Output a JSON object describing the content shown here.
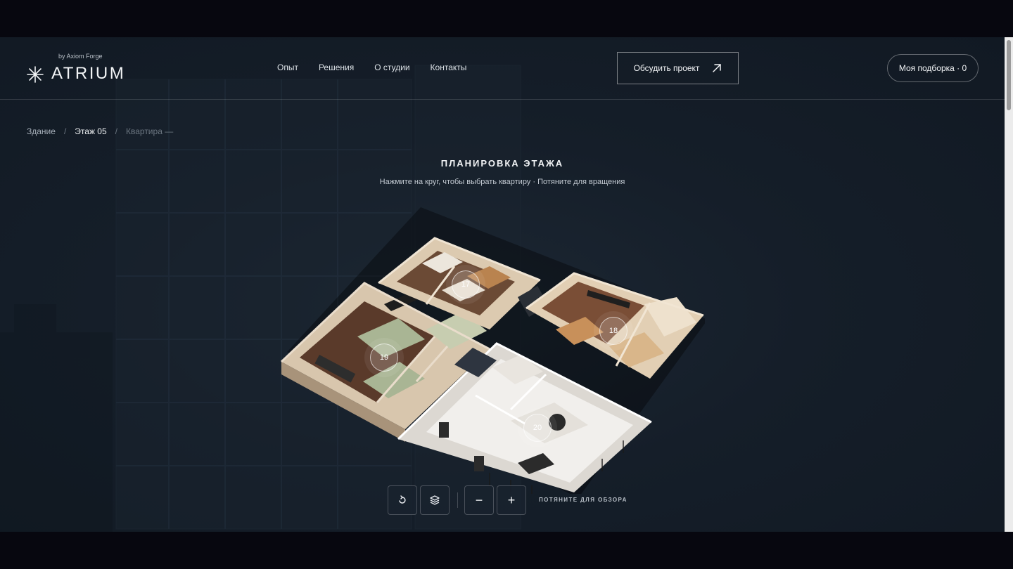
{
  "brand": {
    "sub": "by Axiom Forge",
    "name": "ATRIUM"
  },
  "nav": [
    "Опыт",
    "Решения",
    "О студии",
    "Контакты"
  ],
  "cta": {
    "label": "Обсудить проект",
    "icon": "arrow-up-right-icon"
  },
  "selection": {
    "label": "Моя подборка · 0"
  },
  "breadcrumb": {
    "building": "Здание",
    "floor": "Этаж 05",
    "apartment": "Квартира —",
    "separator": "/"
  },
  "plan": {
    "title": "ПЛАНИРОВКА ЭТАЖА",
    "hint": "Нажмите на круг, чтобы выбрать квартиру · Потяните для вращения",
    "apartments": [
      "17",
      "18",
      "19",
      "20"
    ]
  },
  "controls": {
    "reset_icon": "rotate-reset-icon",
    "layers_icon": "layers-icon",
    "zoom_out": "−",
    "zoom_in": "+",
    "hint": "ПОТЯНИТЕ ДЛЯ ОБЗОРА"
  },
  "colors": {
    "background": "#151e29",
    "accent": "#f2f4f6",
    "letterbox": "#07070f"
  }
}
